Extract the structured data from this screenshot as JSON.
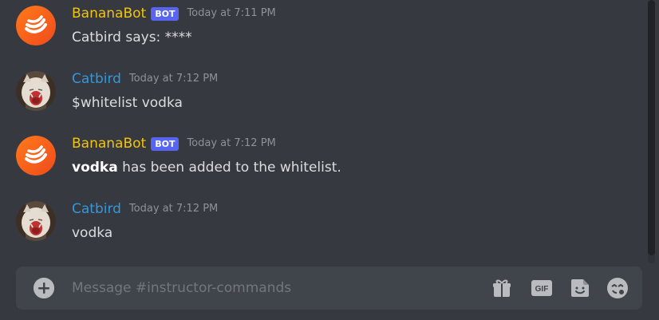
{
  "messages": [
    {
      "author": "BananaBot",
      "bot_tag": "BOT",
      "timestamp": "Today at 7:11 PM",
      "content": "Catbird says: ****"
    },
    {
      "author": "Catbird",
      "timestamp": "Today at 7:12 PM",
      "content": "$whitelist vodka"
    },
    {
      "author": "BananaBot",
      "bot_tag": "BOT",
      "timestamp": "Today at 7:12 PM",
      "content_bold": "vodka",
      "content_rest": " has been added to the whitelist."
    },
    {
      "author": "Catbird",
      "timestamp": "Today at 7:12 PM",
      "content": "vodka"
    }
  ],
  "composer": {
    "placeholder": "Message #instructor-commands",
    "icons": [
      "plus-circle-icon",
      "gift-icon",
      "gif-icon",
      "sticker-icon",
      "emoji-icon"
    ]
  },
  "colors": {
    "background": "#36393f",
    "composer_bg": "#40444b",
    "bot_name": "#f1c40f",
    "user_name": "#3498db",
    "bot_tag": "#5865f2",
    "timestamp": "#8e9297",
    "text": "#dcddde"
  }
}
